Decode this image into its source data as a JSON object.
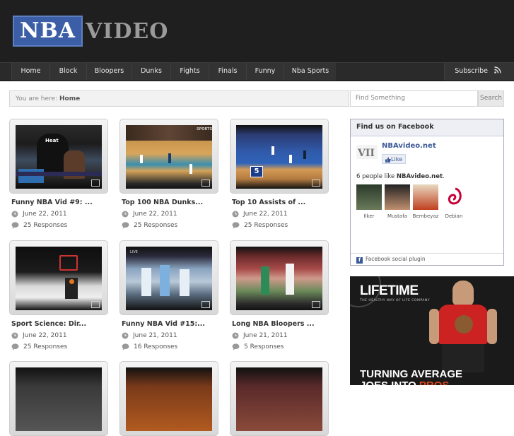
{
  "header": {
    "logo_main": "NBA",
    "logo_rest": "VIDEO"
  },
  "nav": {
    "items": [
      "Home",
      "Block",
      "Bloopers",
      "Dunks",
      "Fights",
      "Finals",
      "Funny",
      "Nba Sports"
    ],
    "subscribe": "Subscribe"
  },
  "breadcrumb": {
    "prefix": "You are here:",
    "current": "Home"
  },
  "search": {
    "placeholder": "Find Something",
    "button": "Search"
  },
  "videos": [
    {
      "title": "Funny NBA Vid #9: ...",
      "date": "June 22, 2011",
      "responses": "25 Responses"
    },
    {
      "title": "Top 100 NBA Dunks...",
      "date": "June 22, 2011",
      "responses": "25 Responses"
    },
    {
      "title": "Top 10 Assists of ...",
      "date": "June 22, 2011",
      "responses": "25 Responses"
    },
    {
      "title": "Sport Science: Dir...",
      "date": "June 22, 2011",
      "responses": "25 Responses"
    },
    {
      "title": "Funny NBA Vid #15:...",
      "date": "June 21, 2011",
      "responses": "16 Responses"
    },
    {
      "title": "Long NBA Bloopers ...",
      "date": "June 21, 2011",
      "responses": "5 Responses"
    }
  ],
  "facebook": {
    "heading": "Find us on Facebook",
    "page_name": "NBAvideo.net",
    "like": "Like",
    "count_prefix": "6 people like",
    "count_page": "NBAvideo.net",
    "fans": [
      "Ilker",
      "Mustafa",
      "Bembeyaz",
      "Debian"
    ],
    "footer": "Facebook social plugin"
  },
  "ad": {
    "brand": "LIFETIME",
    "tagline": "THE HEALTHY WAY OF LIFE COMPANY",
    "headline_1": "TURNING AVERAGE",
    "headline_2a": "JOES INTO ",
    "headline_2b": "PROS"
  },
  "colors": {
    "header_bg": "#1f1f1f",
    "logo_blue": "#3b5ea6",
    "fb_blue": "#3b5998",
    "ad_accent": "#d9481f"
  }
}
